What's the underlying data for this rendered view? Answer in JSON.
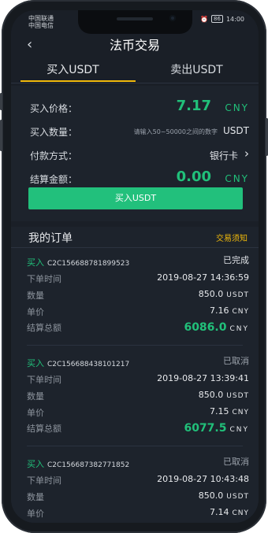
{
  "status_bar": {
    "carrier1": "中国联通",
    "carrier2": "中国电信",
    "battery": "86",
    "time": "14:00"
  },
  "header": {
    "title": "法币交易",
    "back_icon": "chevron-left-icon"
  },
  "tabs": [
    {
      "label": "买入USDT",
      "active": true
    },
    {
      "label": "卖出USDT",
      "active": false
    }
  ],
  "form": {
    "price_label": "买入价格：",
    "price_value": "7.17",
    "price_unit": "CNY",
    "qty_label": "买入数量：",
    "qty_placeholder": "请输入50~50000之间的数字",
    "qty_unit": "USDT",
    "pay_label": "付款方式：",
    "pay_value": "银行卡",
    "settle_label": "结算金额：",
    "settle_value": "0.00",
    "settle_unit": "CNY",
    "buy_button": "买入USDT"
  },
  "orders_section": {
    "title": "我的订单",
    "notice_link": "交易须知",
    "labels": {
      "time": "下单时间",
      "qty": "数量",
      "price": "单价",
      "total": "结算总额"
    },
    "orders": [
      {
        "side": "买入",
        "id": "C2C156688781899523",
        "status": "已完成",
        "time": "2019-08-27 14:36:59",
        "qty": "850.0",
        "qty_unit": "USDT",
        "price": "7.16",
        "price_unit": "CNY",
        "total": "6086.0",
        "total_unit": "CNY"
      },
      {
        "side": "买入",
        "id": "C2C156688438101217",
        "status": "已取消",
        "time": "2019-08-27 13:39:41",
        "qty": "850.0",
        "qty_unit": "USDT",
        "price": "7.15",
        "price_unit": "CNY",
        "total": "6077.5",
        "total_unit": "CNY"
      },
      {
        "side": "买入",
        "id": "C2C156687382771852",
        "status": "已取消",
        "time": "2019-08-27 10:43:48",
        "qty": "850.0",
        "qty_unit": "USDT",
        "price": "7.14",
        "price_unit": "CNY"
      }
    ]
  },
  "colors": {
    "accent_green": "#21c07a",
    "accent_gold": "#f0b90b",
    "background": "#1a1f27"
  }
}
